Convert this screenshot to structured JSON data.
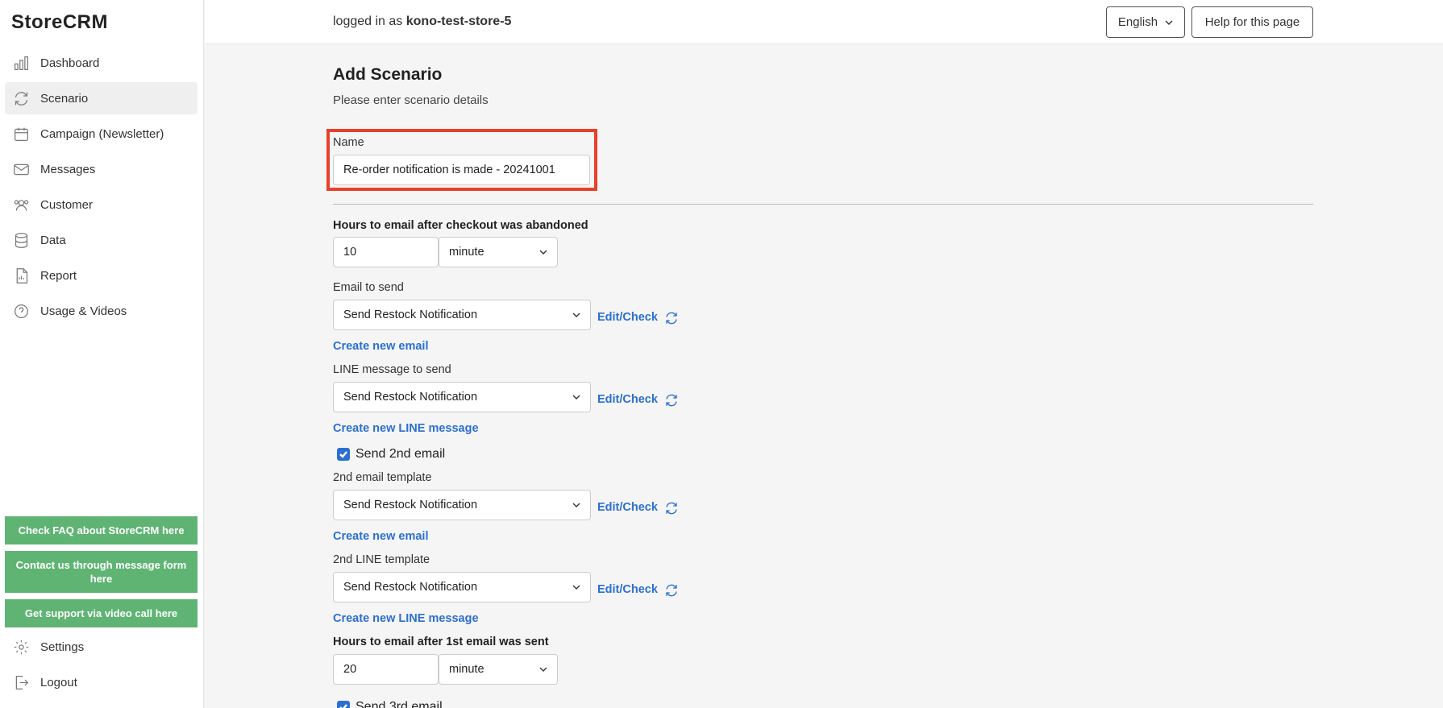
{
  "app": {
    "logo": "StoreCRM"
  },
  "sidebar": {
    "items": [
      {
        "label": "Dashboard",
        "icon": "bar-chart-icon"
      },
      {
        "label": "Scenario",
        "icon": "refresh-icon",
        "active": true
      },
      {
        "label": "Campaign (Newsletter)",
        "icon": "calendar-icon"
      },
      {
        "label": "Messages",
        "icon": "envelope-icon"
      },
      {
        "label": "Customer",
        "icon": "users-icon"
      },
      {
        "label": "Data",
        "icon": "database-icon"
      },
      {
        "label": "Report",
        "icon": "document-icon"
      },
      {
        "label": "Usage & Videos",
        "icon": "help-circle-icon"
      }
    ],
    "support": {
      "faq": "Check FAQ about StoreCRM here",
      "contact": "Contact us through message form here",
      "video": "Get support via video call here"
    },
    "bottom": {
      "settings": "Settings",
      "logout": "Logout"
    }
  },
  "header": {
    "login_prefix": "logged in as",
    "store": "kono-test-store-5",
    "language": "English",
    "help": "Help for this page"
  },
  "form": {
    "title": "Add Scenario",
    "subtitle": "Please enter scenario details",
    "name_label": "Name",
    "name_value": "Re-order notification is made - 20241001",
    "hours1_label": "Hours to email after checkout was abandoned",
    "hours1_value": "10",
    "hours1_unit": "minute",
    "email_label": "Email to send",
    "email_value": "Send Restock Notification",
    "edit_check": "Edit/Check",
    "create_email": "Create new email",
    "line_label": "LINE message to send",
    "line_value": "Send Restock Notification",
    "create_line": "Create new LINE message",
    "send2_label": "Send 2nd email",
    "email2_label": "2nd email template",
    "email2_value": "Send Restock Notification",
    "line2_label": "2nd LINE template",
    "line2_value": "Send Restock Notification",
    "hours2_label": "Hours to email after 1st email was sent",
    "hours2_value": "20",
    "hours2_unit": "minute",
    "send3_label": "Send 3rd email"
  },
  "colors": {
    "accent": "#2b6fd1",
    "support_green": "#5fb474",
    "highlight": "#e8402b"
  }
}
